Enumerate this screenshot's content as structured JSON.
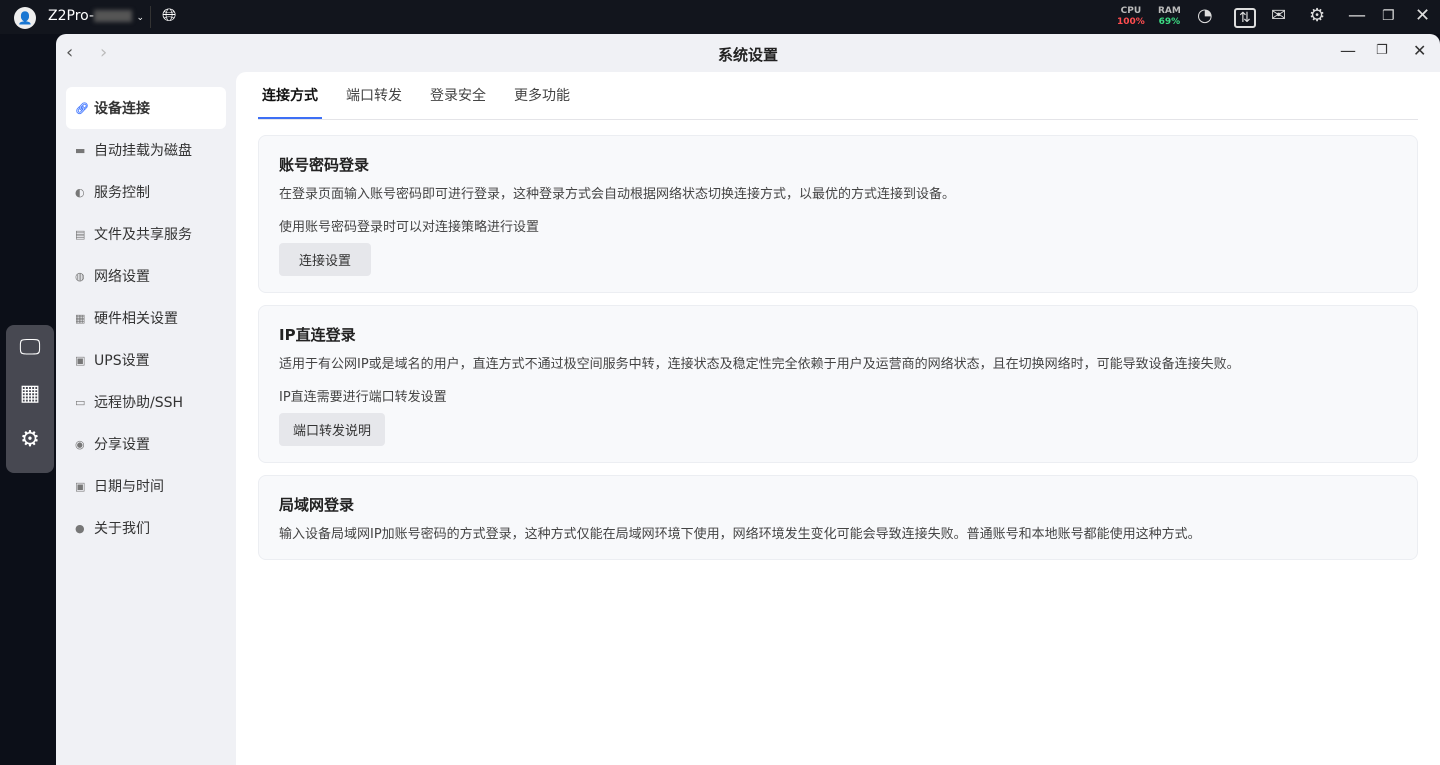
{
  "topbar": {
    "device": "Z2Pro-",
    "cpu_label": "CPU",
    "cpu_value": "100%",
    "ram_label": "RAM",
    "ram_value": "69%",
    "colors": {
      "cpu": "#ff4d4f",
      "ram": "#3ddc84"
    }
  },
  "window": {
    "title": "系统设置"
  },
  "sidebar": {
    "items": [
      {
        "label": "设备连接",
        "icon": "link-icon"
      },
      {
        "label": "自动挂载为磁盘",
        "icon": "disk-icon"
      },
      {
        "label": "服务控制",
        "icon": "toggle-icon"
      },
      {
        "label": "文件及共享服务",
        "icon": "file-icon"
      },
      {
        "label": "网络设置",
        "icon": "globe-icon"
      },
      {
        "label": "硬件相关设置",
        "icon": "grid-icon"
      },
      {
        "label": "UPS设置",
        "icon": "ups-icon"
      },
      {
        "label": "远程协助/SSH",
        "icon": "monitor-icon"
      },
      {
        "label": "分享设置",
        "icon": "share-icon"
      },
      {
        "label": "日期与时间",
        "icon": "calendar-icon"
      },
      {
        "label": "关于我们",
        "icon": "user-icon"
      }
    ]
  },
  "tabs": [
    "连接方式",
    "端口转发",
    "登录安全",
    "更多功能"
  ],
  "cards": [
    {
      "title": "账号密码登录",
      "desc": "在登录页面输入账号密码即可进行登录，这种登录方式会自动根据网络状态切换连接方式，以最优的方式连接到设备。",
      "note": "使用账号密码登录时可以对连接策略进行设置",
      "button": "连接设置"
    },
    {
      "title": "IP直连登录",
      "desc": "适用于有公网IP或是域名的用户，直连方式不通过极空间服务中转，连接状态及稳定性完全依赖于用户及运营商的网络状态，且在切换网络时，可能导致设备连接失败。",
      "note": "IP直连需要进行端口转发设置",
      "button": "端口转发说明"
    },
    {
      "title": "局域网登录",
      "desc": "输入设备局域网IP加账号密码的方式登录，这种方式仅能在局域网环境下使用，网络环境发生变化可能会导致连接失败。普通账号和本地账号都能使用这种方式。"
    }
  ]
}
